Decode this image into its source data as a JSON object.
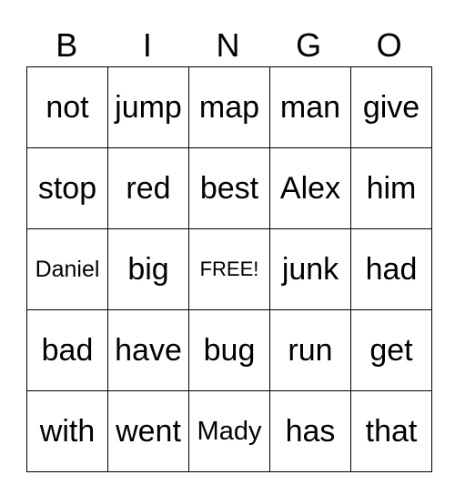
{
  "header": [
    "B",
    "I",
    "N",
    "G",
    "O"
  ],
  "rows": [
    [
      "not",
      "jump",
      "map",
      "man",
      "give"
    ],
    [
      "stop",
      "red",
      "best",
      "Alex",
      "him"
    ],
    [
      "Daniel",
      "big",
      "FREE!",
      "junk",
      "had"
    ],
    [
      "bad",
      "have",
      "bug",
      "run",
      "get"
    ],
    [
      "with",
      "went",
      "Mady",
      "has",
      "that"
    ]
  ]
}
